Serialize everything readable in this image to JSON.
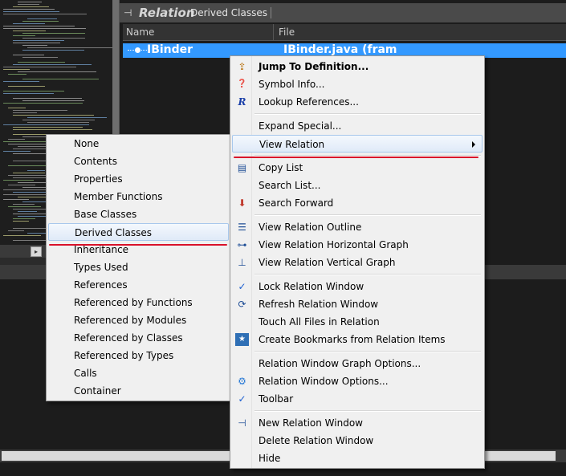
{
  "relation_window": {
    "title": "Relation",
    "subtitle": "Derived Classes",
    "columns": [
      "Name",
      "File"
    ],
    "row": {
      "name": "IBinder",
      "file": "IBinder.java (fram"
    }
  },
  "context_menu": {
    "items": [
      {
        "label": "Jump To Definition...",
        "bold": true,
        "icon": "jump-definition-icon",
        "glyph": "⇪"
      },
      {
        "label": "Symbol Info...",
        "icon": "symbol-info-icon",
        "glyph": "❓"
      },
      {
        "label": "Lookup References...",
        "icon": "lookup-references-icon",
        "glyph": "R"
      },
      {
        "sep": true
      },
      {
        "label": "Expand Special..."
      },
      {
        "label": "View Relation",
        "submenu": true,
        "highlight": true
      },
      {
        "sep": true
      },
      {
        "label": "Copy List",
        "icon": "copy-list-icon",
        "glyph": "▤"
      },
      {
        "label": "Search List..."
      },
      {
        "label": "Search Forward",
        "icon": "search-forward-icon",
        "glyph": "⬇"
      },
      {
        "sep": true
      },
      {
        "label": "View Relation Outline",
        "icon": "outline-icon",
        "glyph": "☰"
      },
      {
        "label": "View Relation Horizontal Graph",
        "icon": "horizontal-graph-icon",
        "glyph": "⊶"
      },
      {
        "label": "View Relation Vertical Graph",
        "icon": "vertical-graph-icon",
        "glyph": "⊥"
      },
      {
        "sep": true
      },
      {
        "label": "Lock Relation Window",
        "icon": "check-icon",
        "glyph": "✓"
      },
      {
        "label": "Refresh Relation Window",
        "icon": "refresh-icon",
        "glyph": "⟳"
      },
      {
        "label": "Touch All Files in Relation"
      },
      {
        "label": "Create Bookmarks from Relation Items",
        "icon": "bookmark-icon",
        "glyph": "★"
      },
      {
        "sep": true
      },
      {
        "label": "Relation Window Graph Options..."
      },
      {
        "label": "Relation Window Options...",
        "icon": "gear-icon",
        "glyph": "⚙"
      },
      {
        "label": "Toolbar",
        "icon": "check-icon",
        "glyph": "✓"
      },
      {
        "sep": true
      },
      {
        "label": "New Relation Window",
        "icon": "new-relation-icon",
        "glyph": "⊣"
      },
      {
        "label": "Delete Relation Window"
      },
      {
        "label": "Hide"
      }
    ]
  },
  "submenu": {
    "items": [
      "None",
      "Contents",
      "Properties",
      "Member Functions",
      "Base Classes",
      "Derived Classes",
      "Inheritance",
      "Types Used",
      "References",
      "Referenced by Functions",
      "Referenced by Modules",
      "Referenced by Classes",
      "Referenced by Types",
      "Calls",
      "Container"
    ],
    "selected": "Derived Classes"
  },
  "colors": {
    "selection_blue": "#3399ff",
    "annotation_red": "#d9122a",
    "check_blue": "#1c5fd0"
  }
}
